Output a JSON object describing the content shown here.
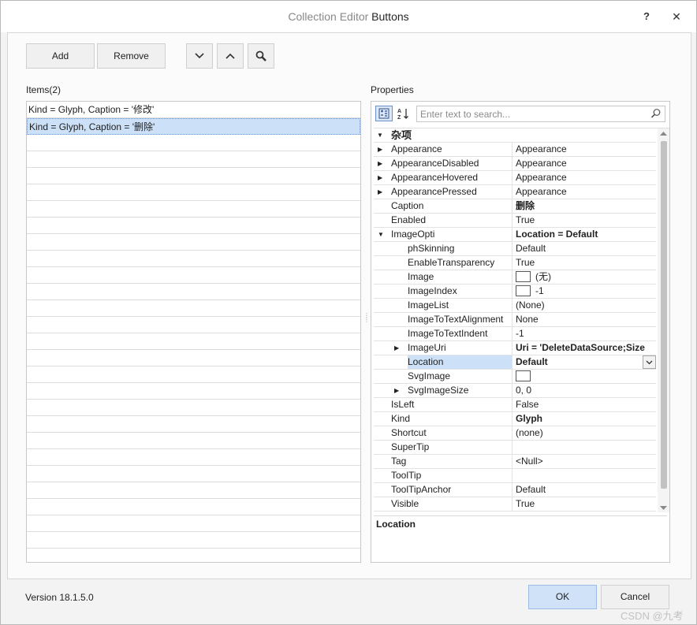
{
  "window": {
    "title_prefix": "Collection Editor",
    "title_main": "Buttons",
    "help_label": "?",
    "close_label": "✕"
  },
  "toolbar": {
    "add_label": "Add",
    "remove_label": "Remove"
  },
  "items": {
    "header": "Items(2)",
    "rows": [
      "Kind = Glyph, Caption = '修改'",
      "Kind = Glyph, Caption = '删除'"
    ],
    "selected_index": 1
  },
  "properties": {
    "header": "Properties",
    "search_placeholder": "Enter text to search...",
    "category": "杂项",
    "rows": [
      {
        "name": "Appearance",
        "value": "Appearance"
      },
      {
        "name": "AppearanceDisabled",
        "value": "Appearance"
      },
      {
        "name": "AppearanceHovered",
        "value": "Appearance"
      },
      {
        "name": "AppearancePressed",
        "value": "Appearance"
      },
      {
        "name": "Caption",
        "value": "删除"
      },
      {
        "name": "Enabled",
        "value": "True"
      },
      {
        "name": "ImageOpti",
        "value": "Location = Default"
      },
      {
        "name": "phSkinning",
        "value": "Default"
      },
      {
        "name": "EnableTransparency",
        "value": "True"
      },
      {
        "name": "Image",
        "value": "(无)"
      },
      {
        "name": "ImageIndex",
        "value": "-1"
      },
      {
        "name": "ImageList",
        "value": "(None)"
      },
      {
        "name": "ImageToTextAlignment",
        "value": "None"
      },
      {
        "name": "ImageToTextIndent",
        "value": "-1"
      },
      {
        "name": "ImageUri",
        "value": "Uri = 'DeleteDataSource;Size"
      },
      {
        "name": "Location",
        "value": "Default"
      },
      {
        "name": "SvgImage",
        "value": ""
      },
      {
        "name": "SvgImageSize",
        "value": "0, 0"
      },
      {
        "name": "IsLeft",
        "value": "False"
      },
      {
        "name": "Kind",
        "value": "Glyph"
      },
      {
        "name": "Shortcut",
        "value": "(none)"
      },
      {
        "name": "SuperTip",
        "value": ""
      },
      {
        "name": "Tag",
        "value": "<Null>"
      },
      {
        "name": "ToolTip",
        "value": ""
      },
      {
        "name": "ToolTipAnchor",
        "value": "Default"
      },
      {
        "name": "Visible",
        "value": "True"
      }
    ],
    "description_title": "Location"
  },
  "footer": {
    "version": "Version 18.1.5.0",
    "ok_label": "OK",
    "cancel_label": "Cancel",
    "watermark": "CSDN @九考"
  },
  "colors": {
    "selection": "#cce0f7",
    "ok_button": "#cfe2f7"
  }
}
